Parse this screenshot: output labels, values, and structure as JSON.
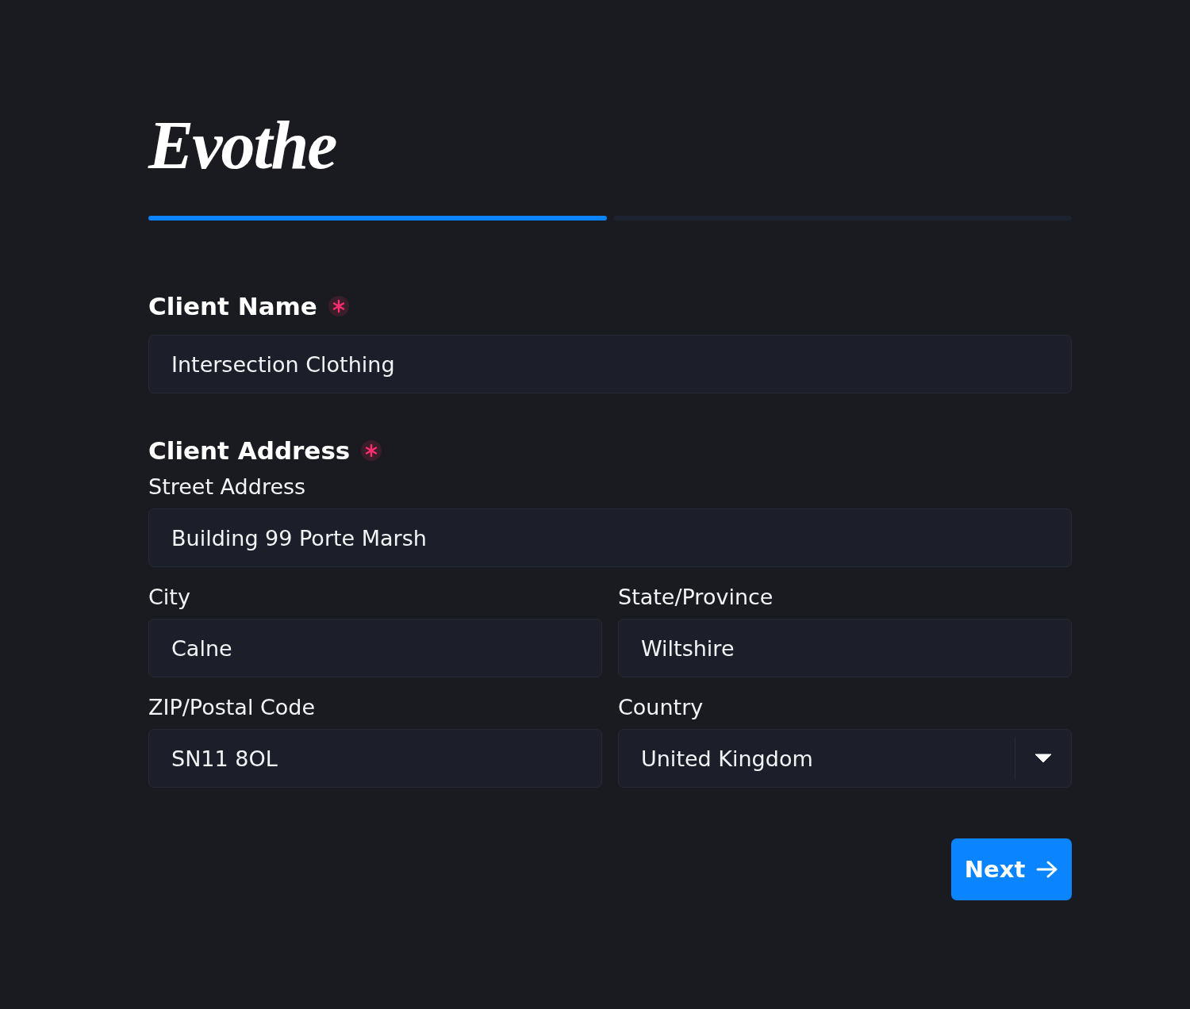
{
  "logo": "Evothe",
  "progress": {
    "steps": [
      {
        "completed": true
      },
      {
        "completed": false
      }
    ]
  },
  "client_name": {
    "label": "Client Name",
    "required": true,
    "value": "Intersection Clothing"
  },
  "client_address": {
    "label": "Client Address",
    "required": true,
    "rows": [
      [
        {
          "kind": "text",
          "label": "Street Address",
          "value": "Building 99 Porte Marsh"
        }
      ],
      [
        {
          "kind": "text",
          "label": "City",
          "value": "Calne"
        },
        {
          "kind": "text",
          "label": "State/Province",
          "value": "Wiltshire"
        }
      ],
      [
        {
          "kind": "text",
          "label": "ZIP/Postal Code",
          "value": "SN11 8OL"
        },
        {
          "kind": "select",
          "label": "Country",
          "value": "United Kingdom"
        }
      ]
    ]
  },
  "next_button": {
    "label": "Next"
  }
}
